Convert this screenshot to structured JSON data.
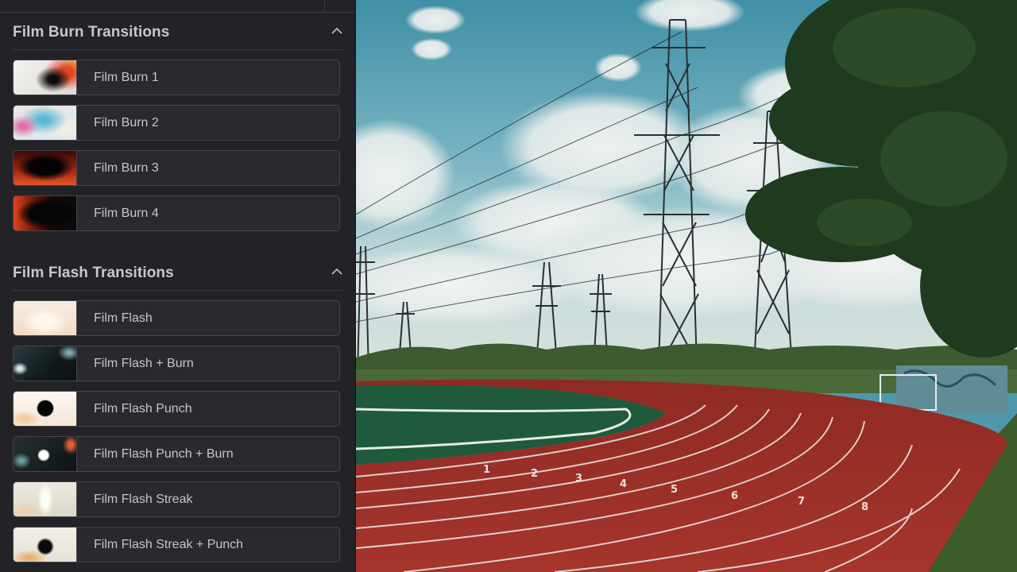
{
  "sections": [
    {
      "title": "Film Burn Transitions",
      "items": [
        {
          "label": "Film Burn 1",
          "thumb": "film-burn-1"
        },
        {
          "label": "Film Burn 2",
          "thumb": "film-burn-2"
        },
        {
          "label": "Film Burn 3",
          "thumb": "film-burn-3"
        },
        {
          "label": "Film Burn 4",
          "thumb": "film-burn-4"
        }
      ]
    },
    {
      "title": "Film Flash Transitions",
      "items": [
        {
          "label": "Film Flash",
          "thumb": "film-flash"
        },
        {
          "label": "Film Flash + Burn",
          "thumb": "film-flash-burn"
        },
        {
          "label": "Film Flash Punch",
          "thumb": "film-flash-punch"
        },
        {
          "label": "Film Flash Punch + Burn",
          "thumb": "film-flash-punch-burn"
        },
        {
          "label": "Film Flash Streak",
          "thumb": "film-flash-streak"
        },
        {
          "label": "Film Flash Streak + Punch",
          "thumb": "film-flash-streak-punch"
        }
      ]
    }
  ],
  "icons": {
    "collapse": "chevron-up-icon"
  },
  "preview": {
    "lane_numbers": [
      "1",
      "2",
      "3",
      "4",
      "5",
      "6",
      "7",
      "8"
    ]
  },
  "colors": {
    "panel_bg": "#232327",
    "item_bg": "#29292e",
    "item_border": "#45454c",
    "title_text": "#c7c7cc",
    "label_text": "#c5c5ca",
    "sky": "#4f98ac",
    "track": "#9a2d26",
    "field": "#1f5a3c"
  }
}
